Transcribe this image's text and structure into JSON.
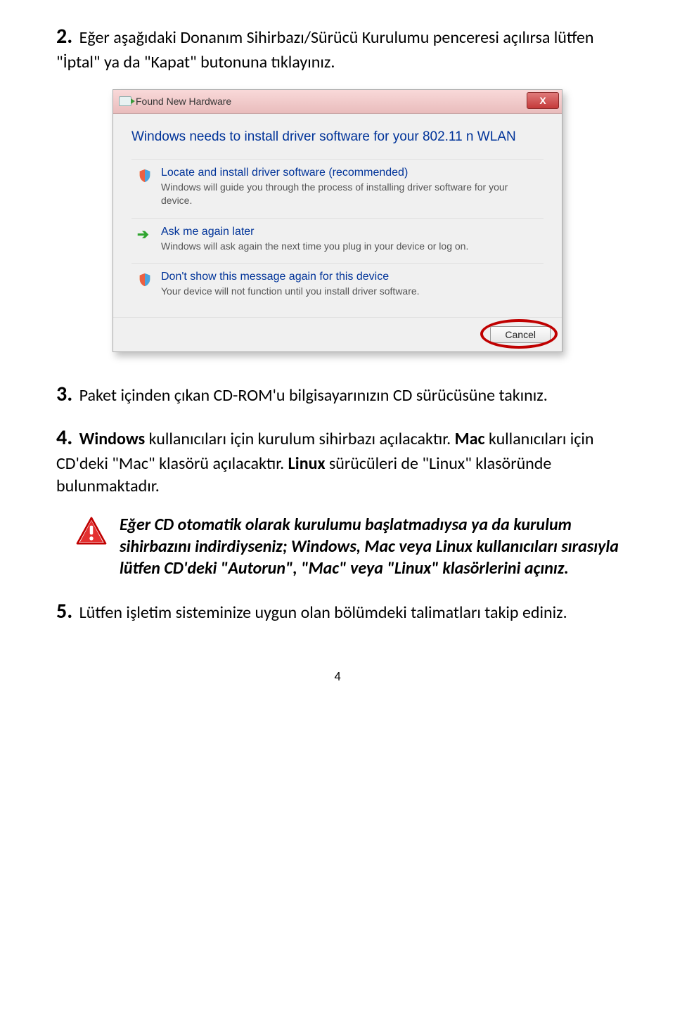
{
  "steps": {
    "s2": {
      "num": "2.",
      "text": "Eğer aşağıdaki Donanım Sihirbazı/Sürücü Kurulumu penceresi açılırsa lütfen \"İptal\" ya da \"Kapat\" butonuna tıklayınız."
    },
    "s3": {
      "num": "3.",
      "text": "Paket içinden çıkan CD-ROM'u bilgisayarınızın CD sürücüsüne takınız."
    },
    "s4": {
      "num": "4.",
      "lead_bold": "Windows",
      "lead_rest": " kullanıcıları için kurulum sihirbazı açılacaktır. ",
      "mac_bold": "Mac",
      "mac_rest": " kullanıcıları için CD'deki \"Mac\" klasörü açılacaktır. ",
      "linux_bold": "Linux",
      "linux_rest": " sürücüleri de \"Linux\" klasöründe bulunmaktadır."
    },
    "s5": {
      "num": "5.",
      "text": "Lütfen işletim sisteminize uygun olan bölümdeki talimatları takip ediniz."
    }
  },
  "dialog": {
    "title": "Found New Hardware",
    "headline": "Windows needs to install driver software for your 802.11 n WLAN",
    "opt1": {
      "title": "Locate and install driver software (recommended)",
      "desc": "Windows will guide you through the process of installing driver software for your device."
    },
    "opt2": {
      "title": "Ask me again later",
      "desc": "Windows will ask again the next time you plug in your device or log on."
    },
    "opt3": {
      "title": "Don't show this message again for this device",
      "desc": "Your device will not function until you install driver software."
    },
    "cancel": "Cancel",
    "close_x": "X"
  },
  "warning": {
    "text": "Eğer CD otomatik olarak kurulumu başlatmadıysa ya da kurulum sihirbazını indirdiyseniz; Windows, Mac veya Linux kullanıcıları sırasıyla lütfen CD'deki \"Autorun\", \"Mac\" veya \"Linux\" klasörlerini açınız."
  },
  "page_number": "4"
}
